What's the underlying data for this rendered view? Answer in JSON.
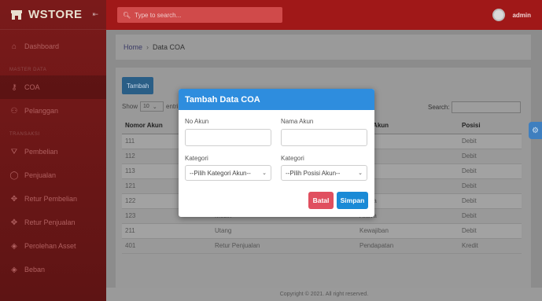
{
  "brand": {
    "name": "WSTORE",
    "collapse": "⇤"
  },
  "topbar": {
    "search_placeholder": "Type to search...",
    "user": "admin"
  },
  "sidebar": {
    "items": [
      {
        "label": "Dashboard",
        "icon": "⌂"
      },
      {
        "label": "COA",
        "icon": "⚷"
      },
      {
        "label": "Pelanggan",
        "icon": "⚇"
      },
      {
        "label": "Pembelian",
        "icon": "⛛"
      },
      {
        "label": "Penjualan",
        "icon": "◯"
      },
      {
        "label": "Retur Pembelian",
        "icon": "✥"
      },
      {
        "label": "Retur Penjualan",
        "icon": "✥"
      },
      {
        "label": "Perolehan Asset",
        "icon": "◈"
      },
      {
        "label": "Beban",
        "icon": "◈"
      }
    ],
    "heading_master": "MASTER DATA",
    "heading_transaksi": "TRANSAKSI"
  },
  "breadcrumb": {
    "home": "Home",
    "sep": "›",
    "current": "Data COA"
  },
  "card": {
    "add_button": "Tambah",
    "show_label": "Show",
    "show_value": "10",
    "entries_label": "entri",
    "search_label": "Search:"
  },
  "table": {
    "headers": [
      "Nomor Akun",
      "",
      "gori Akun",
      "Posisi"
    ],
    "rows": [
      [
        "111",
        "",
        "va",
        "Debit"
      ],
      [
        "112",
        "",
        "va",
        "Debit"
      ],
      [
        "113",
        "",
        "va",
        "Debit"
      ],
      [
        "121",
        "",
        "va",
        "Debit"
      ],
      [
        "122",
        "",
        "Aktiva",
        "Debit"
      ],
      [
        "123",
        "Mesin",
        "Aktiva",
        "Debit"
      ],
      [
        "211",
        "Utang",
        "Kewajiban",
        "Debit"
      ],
      [
        "401",
        "Retur Penjualan",
        "Pendapatan",
        "Kredit"
      ]
    ]
  },
  "footer": {
    "text": "Copyright © 2021. All right reserved."
  },
  "modal": {
    "title": "Tambah Data COA",
    "no_akun_label": "No Akun",
    "nama_akun_label": "Nama Akun",
    "kategori_label_1": "Kategori",
    "kategori_label_2": "Kategori",
    "kategori_select": "--Pilih Kategori Akun--",
    "posisi_select": "--Pilih Posisi Akun--",
    "batal": "Batal",
    "simpan": "Simpan"
  },
  "colors": {
    "sidebar": "#7a1a1a",
    "topbar": "#a01818",
    "modal_header": "#2e8dde",
    "batal": "#e04f5f",
    "simpan": "#1a8ad6"
  }
}
